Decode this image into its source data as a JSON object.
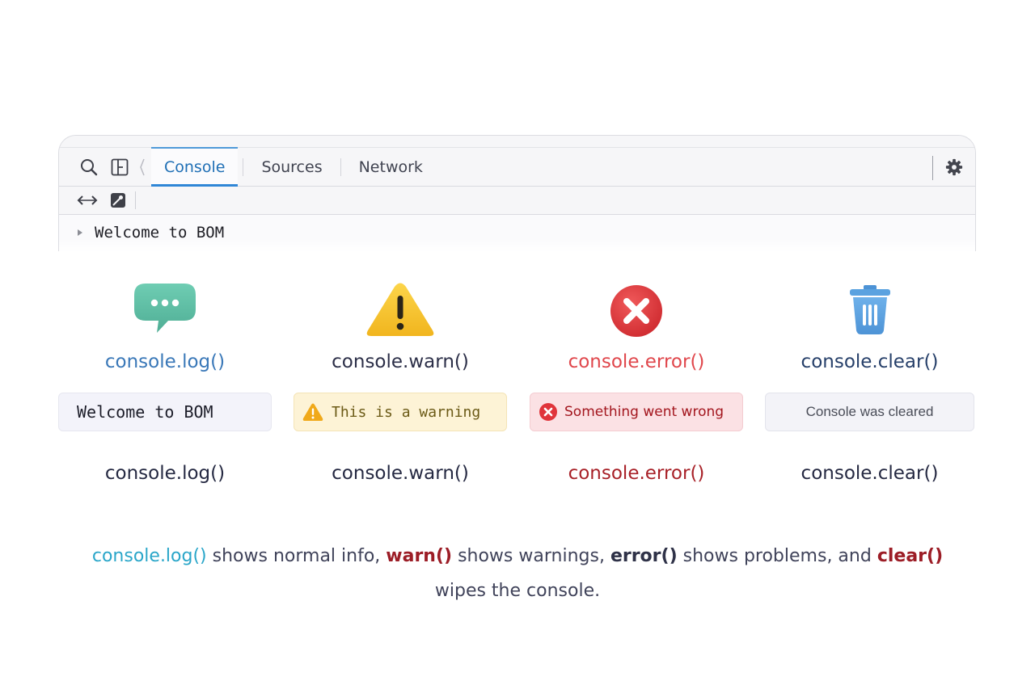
{
  "devtools": {
    "tabs": [
      {
        "label": "Console",
        "active": true
      },
      {
        "label": "Sources",
        "active": false
      },
      {
        "label": "Network",
        "active": false
      }
    ],
    "console_output": "Welcome to BOM"
  },
  "methods": [
    {
      "icon": "chat-bubble-icon",
      "name": "console.log()",
      "output": "Welcome to BOM",
      "caption": "console.log()"
    },
    {
      "icon": "warning-triangle-icon",
      "name": "console.warn()",
      "output": "This is a warning",
      "caption": "console.warn()"
    },
    {
      "icon": "error-circle-icon",
      "name": "console.error()",
      "output": "Something went wrong",
      "caption": "console.error()"
    },
    {
      "icon": "trash-can-icon",
      "name": "console.clear()",
      "output": "Console was cleared",
      "caption": "console.clear()"
    }
  ],
  "summary": {
    "log": "console.log()",
    "t1": " shows normal info, ",
    "warn": "warn()",
    "t2": " shows warnings, ",
    "error": "error()",
    "t3": " shows problems, and ",
    "clear": "clear()",
    "t4": " wipes the console."
  },
  "colors": {
    "accent_blue": "#2f86d6",
    "log": "#3a78b8",
    "warn_bg": "#fdf3d6",
    "error_red": "#e0474c",
    "error_bg": "#fbe1e4",
    "clear_navy": "#27406a"
  }
}
